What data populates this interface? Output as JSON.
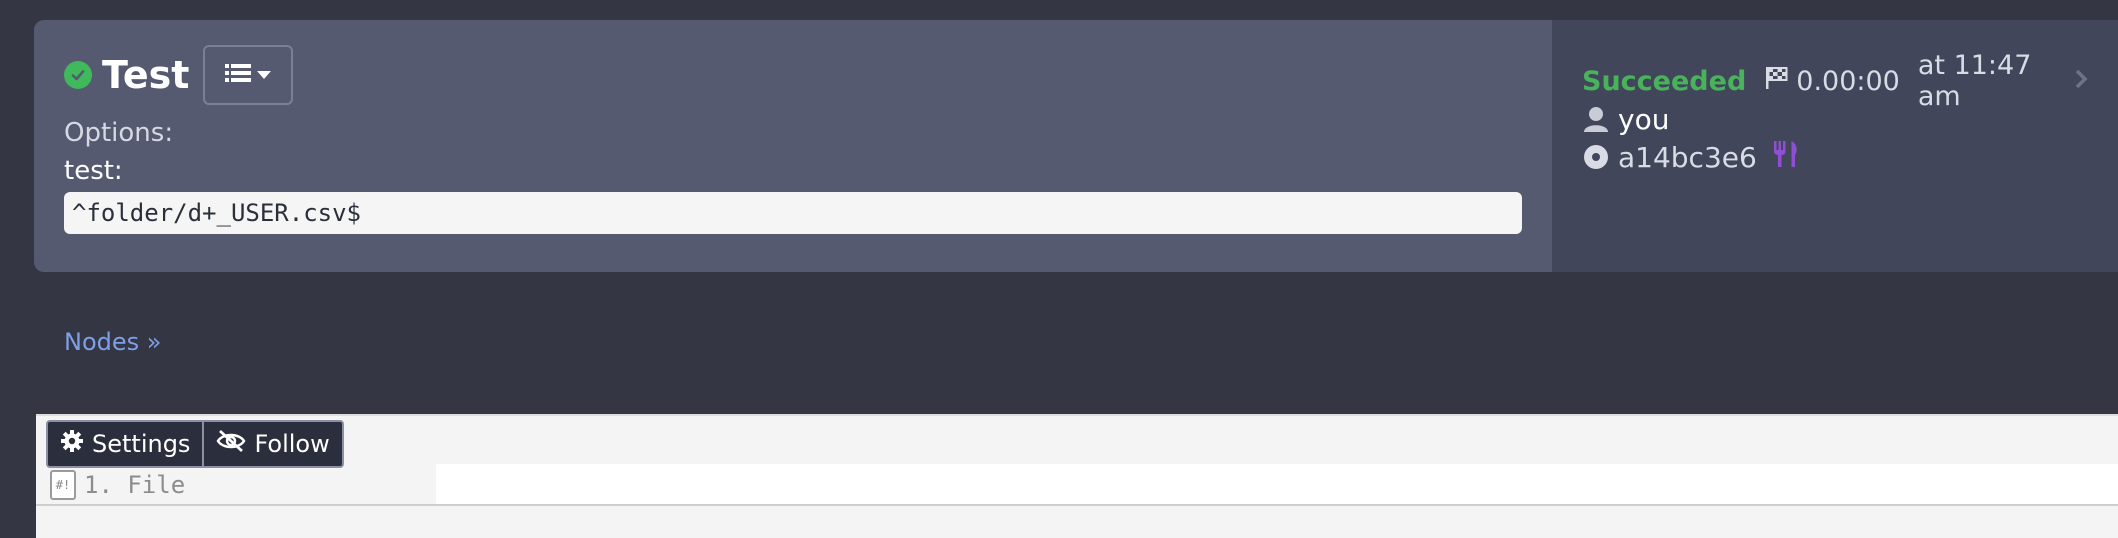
{
  "execution": {
    "title": "Test",
    "options_label": "Options:",
    "option_name": "test:",
    "option_value": "^folder/d+_USER.csv$"
  },
  "summary": {
    "status": "Succeeded",
    "duration": "0.00:00",
    "at_time": "at 11:47 am",
    "user": "you",
    "commit": "a14bc3e6"
  },
  "nav": {
    "nodes_link": "Nodes »"
  },
  "log": {
    "settings_label": "Settings",
    "follow_label": "Follow",
    "line_label": "1. File",
    "file_icon_text": "#!"
  },
  "colors": {
    "success": "#48b35a",
    "accent_link": "#7f9fe6",
    "fork_purple": "#8e4fd3"
  },
  "icons": [
    "check-circle-icon",
    "list-icon",
    "caret-down-icon",
    "flag-icon",
    "chevron-right-icon",
    "user-icon",
    "disc-icon",
    "fork-knife-icon",
    "gear-icon",
    "eye-slash-icon",
    "file-icon"
  ]
}
